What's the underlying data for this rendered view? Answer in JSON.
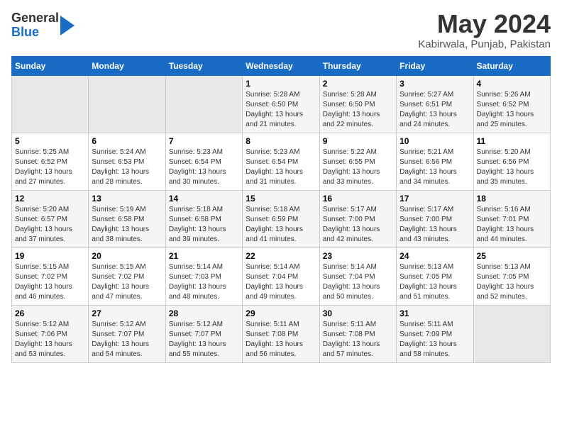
{
  "logo": {
    "line1": "General",
    "line2": "Blue"
  },
  "title": "May 2024",
  "location": "Kabirwala, Punjab, Pakistan",
  "days_header": [
    "Sunday",
    "Monday",
    "Tuesday",
    "Wednesday",
    "Thursday",
    "Friday",
    "Saturday"
  ],
  "weeks": [
    [
      {
        "num": "",
        "sunrise": "",
        "sunset": "",
        "daylight": ""
      },
      {
        "num": "",
        "sunrise": "",
        "sunset": "",
        "daylight": ""
      },
      {
        "num": "",
        "sunrise": "",
        "sunset": "",
        "daylight": ""
      },
      {
        "num": "1",
        "sunrise": "Sunrise: 5:28 AM",
        "sunset": "Sunset: 6:50 PM",
        "daylight": "Daylight: 13 hours and 21 minutes."
      },
      {
        "num": "2",
        "sunrise": "Sunrise: 5:28 AM",
        "sunset": "Sunset: 6:50 PM",
        "daylight": "Daylight: 13 hours and 22 minutes."
      },
      {
        "num": "3",
        "sunrise": "Sunrise: 5:27 AM",
        "sunset": "Sunset: 6:51 PM",
        "daylight": "Daylight: 13 hours and 24 minutes."
      },
      {
        "num": "4",
        "sunrise": "Sunrise: 5:26 AM",
        "sunset": "Sunset: 6:52 PM",
        "daylight": "Daylight: 13 hours and 25 minutes."
      }
    ],
    [
      {
        "num": "5",
        "sunrise": "Sunrise: 5:25 AM",
        "sunset": "Sunset: 6:52 PM",
        "daylight": "Daylight: 13 hours and 27 minutes."
      },
      {
        "num": "6",
        "sunrise": "Sunrise: 5:24 AM",
        "sunset": "Sunset: 6:53 PM",
        "daylight": "Daylight: 13 hours and 28 minutes."
      },
      {
        "num": "7",
        "sunrise": "Sunrise: 5:23 AM",
        "sunset": "Sunset: 6:54 PM",
        "daylight": "Daylight: 13 hours and 30 minutes."
      },
      {
        "num": "8",
        "sunrise": "Sunrise: 5:23 AM",
        "sunset": "Sunset: 6:54 PM",
        "daylight": "Daylight: 13 hours and 31 minutes."
      },
      {
        "num": "9",
        "sunrise": "Sunrise: 5:22 AM",
        "sunset": "Sunset: 6:55 PM",
        "daylight": "Daylight: 13 hours and 33 minutes."
      },
      {
        "num": "10",
        "sunrise": "Sunrise: 5:21 AM",
        "sunset": "Sunset: 6:56 PM",
        "daylight": "Daylight: 13 hours and 34 minutes."
      },
      {
        "num": "11",
        "sunrise": "Sunrise: 5:20 AM",
        "sunset": "Sunset: 6:56 PM",
        "daylight": "Daylight: 13 hours and 35 minutes."
      }
    ],
    [
      {
        "num": "12",
        "sunrise": "Sunrise: 5:20 AM",
        "sunset": "Sunset: 6:57 PM",
        "daylight": "Daylight: 13 hours and 37 minutes."
      },
      {
        "num": "13",
        "sunrise": "Sunrise: 5:19 AM",
        "sunset": "Sunset: 6:58 PM",
        "daylight": "Daylight: 13 hours and 38 minutes."
      },
      {
        "num": "14",
        "sunrise": "Sunrise: 5:18 AM",
        "sunset": "Sunset: 6:58 PM",
        "daylight": "Daylight: 13 hours and 39 minutes."
      },
      {
        "num": "15",
        "sunrise": "Sunrise: 5:18 AM",
        "sunset": "Sunset: 6:59 PM",
        "daylight": "Daylight: 13 hours and 41 minutes."
      },
      {
        "num": "16",
        "sunrise": "Sunrise: 5:17 AM",
        "sunset": "Sunset: 7:00 PM",
        "daylight": "Daylight: 13 hours and 42 minutes."
      },
      {
        "num": "17",
        "sunrise": "Sunrise: 5:17 AM",
        "sunset": "Sunset: 7:00 PM",
        "daylight": "Daylight: 13 hours and 43 minutes."
      },
      {
        "num": "18",
        "sunrise": "Sunrise: 5:16 AM",
        "sunset": "Sunset: 7:01 PM",
        "daylight": "Daylight: 13 hours and 44 minutes."
      }
    ],
    [
      {
        "num": "19",
        "sunrise": "Sunrise: 5:15 AM",
        "sunset": "Sunset: 7:02 PM",
        "daylight": "Daylight: 13 hours and 46 minutes."
      },
      {
        "num": "20",
        "sunrise": "Sunrise: 5:15 AM",
        "sunset": "Sunset: 7:02 PM",
        "daylight": "Daylight: 13 hours and 47 minutes."
      },
      {
        "num": "21",
        "sunrise": "Sunrise: 5:14 AM",
        "sunset": "Sunset: 7:03 PM",
        "daylight": "Daylight: 13 hours and 48 minutes."
      },
      {
        "num": "22",
        "sunrise": "Sunrise: 5:14 AM",
        "sunset": "Sunset: 7:04 PM",
        "daylight": "Daylight: 13 hours and 49 minutes."
      },
      {
        "num": "23",
        "sunrise": "Sunrise: 5:14 AM",
        "sunset": "Sunset: 7:04 PM",
        "daylight": "Daylight: 13 hours and 50 minutes."
      },
      {
        "num": "24",
        "sunrise": "Sunrise: 5:13 AM",
        "sunset": "Sunset: 7:05 PM",
        "daylight": "Daylight: 13 hours and 51 minutes."
      },
      {
        "num": "25",
        "sunrise": "Sunrise: 5:13 AM",
        "sunset": "Sunset: 7:05 PM",
        "daylight": "Daylight: 13 hours and 52 minutes."
      }
    ],
    [
      {
        "num": "26",
        "sunrise": "Sunrise: 5:12 AM",
        "sunset": "Sunset: 7:06 PM",
        "daylight": "Daylight: 13 hours and 53 minutes."
      },
      {
        "num": "27",
        "sunrise": "Sunrise: 5:12 AM",
        "sunset": "Sunset: 7:07 PM",
        "daylight": "Daylight: 13 hours and 54 minutes."
      },
      {
        "num": "28",
        "sunrise": "Sunrise: 5:12 AM",
        "sunset": "Sunset: 7:07 PM",
        "daylight": "Daylight: 13 hours and 55 minutes."
      },
      {
        "num": "29",
        "sunrise": "Sunrise: 5:11 AM",
        "sunset": "Sunset: 7:08 PM",
        "daylight": "Daylight: 13 hours and 56 minutes."
      },
      {
        "num": "30",
        "sunrise": "Sunrise: 5:11 AM",
        "sunset": "Sunset: 7:08 PM",
        "daylight": "Daylight: 13 hours and 57 minutes."
      },
      {
        "num": "31",
        "sunrise": "Sunrise: 5:11 AM",
        "sunset": "Sunset: 7:09 PM",
        "daylight": "Daylight: 13 hours and 58 minutes."
      },
      {
        "num": "",
        "sunrise": "",
        "sunset": "",
        "daylight": ""
      }
    ]
  ]
}
